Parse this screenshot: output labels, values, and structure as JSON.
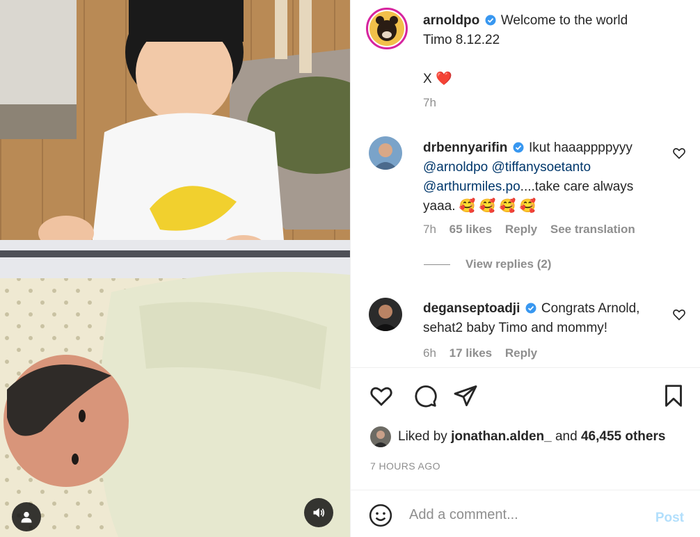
{
  "post": {
    "caption": {
      "username": "arnoldpo",
      "verified": true,
      "line1": "Welcome to the world",
      "line2": "Timo 8.12.22",
      "line3": "X",
      "heart": "❤️",
      "time": "7h"
    }
  },
  "comments": [
    {
      "username": "drbennyarifin",
      "verified": true,
      "text_intro": "Ikut haaappppyyy",
      "mention1": "@arnoldpo",
      "mention2": "@tiffanysoetanto",
      "mention3": "@arthurmiles.po",
      "text_outro": "....take care always",
      "text_end": "yaaa. 🥰 🥰 🥰 🥰",
      "time": "7h",
      "likes": "65 likes",
      "reply": "Reply",
      "translate": "See translation",
      "view_replies": "View replies (2)"
    },
    {
      "username": "deganseptoadji",
      "verified": true,
      "text_line1": "Congrats Arnold,",
      "text_line2": "sehat2 baby Timo and mommy!",
      "time": "6h",
      "likes": "17 likes",
      "reply": "Reply"
    }
  ],
  "likes": {
    "prefix": "Liked by",
    "user": "jonathan.alden_",
    "and": "and",
    "others": "46,455 others"
  },
  "timestamp": "7 HOURS AGO",
  "composer": {
    "placeholder": "Add a comment...",
    "post_label": "Post"
  },
  "colors": {
    "verified": "#3897f0",
    "mention": "#00376b",
    "muted": "#8e8e8e",
    "post_disabled": "#b2dffc",
    "heart_red": "#ed4956"
  },
  "icons": {
    "like": "heart-icon",
    "comment": "comment-icon",
    "share": "share-icon",
    "save": "bookmark-icon",
    "emoji": "emoji-icon",
    "tag": "user-tag-icon",
    "sound": "speaker-icon"
  }
}
